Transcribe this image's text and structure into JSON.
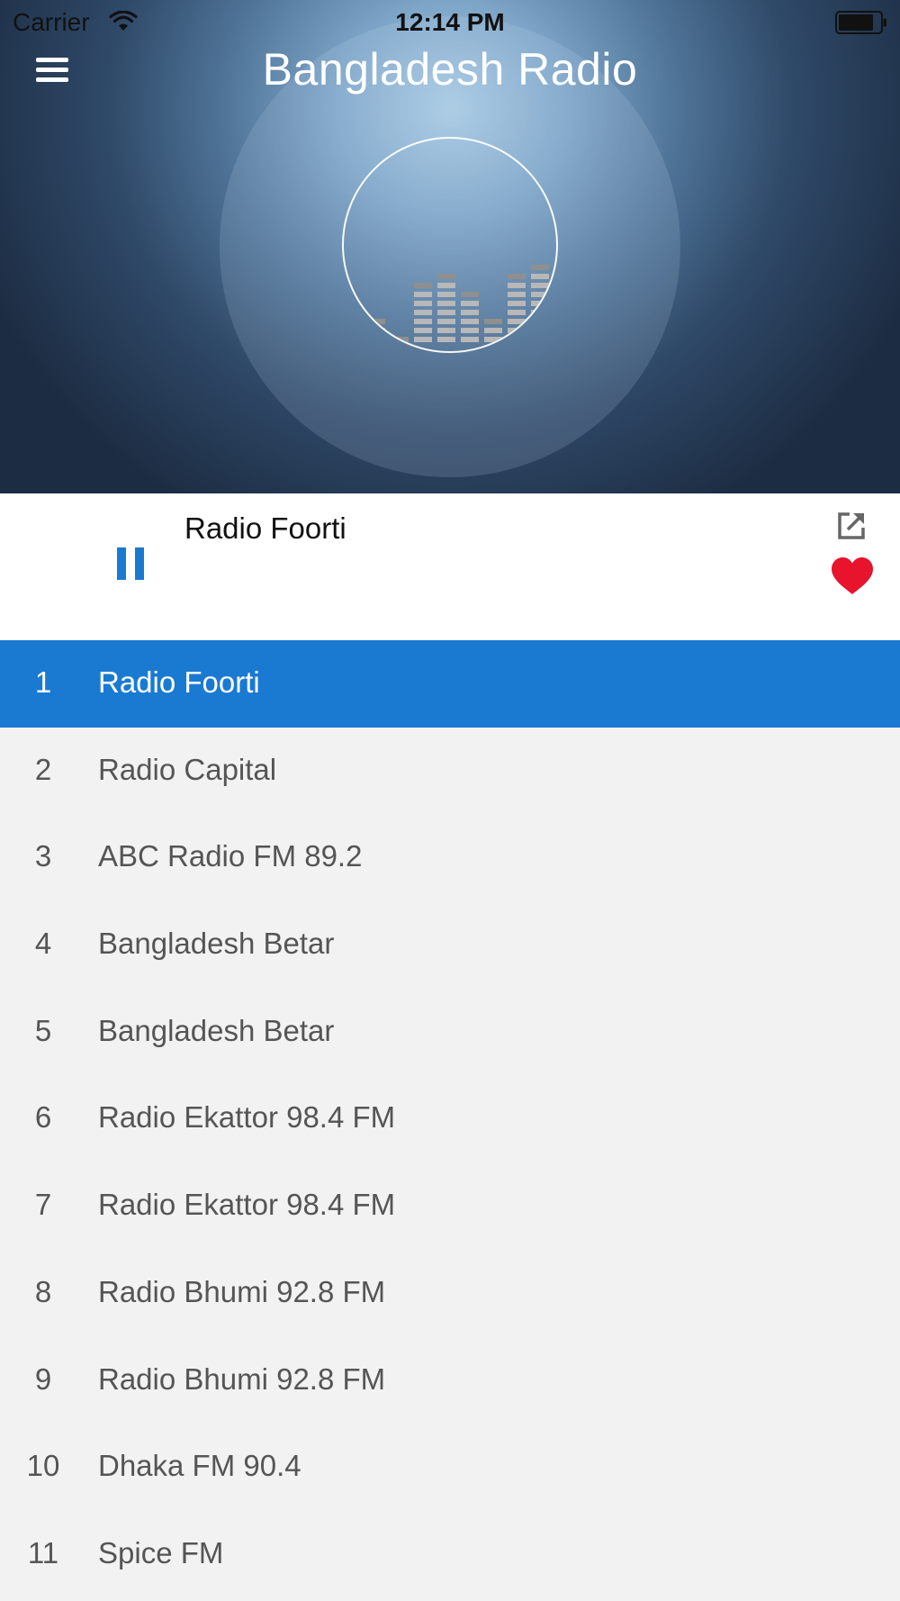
{
  "status_bar": {
    "carrier": "Carrier",
    "time": "12:14 PM"
  },
  "header": {
    "title": "Bangladesh Radio",
    "menu_icon": "hamburger-menu-icon"
  },
  "colors": {
    "accent": "#1a7ad2",
    "favorite": "#e8132d",
    "list_background": "#f2f2f2"
  },
  "now_playing": {
    "station": "Radio Foorti",
    "state": "playing",
    "control_icon": "pause-icon",
    "share_icon": "share-external-icon",
    "favorite_icon": "heart-icon",
    "favorited": true
  },
  "stations": [
    {
      "number": "1",
      "name": "Radio Foorti",
      "active": true
    },
    {
      "number": "2",
      "name": "Radio Capital",
      "active": false
    },
    {
      "number": "3",
      "name": "ABC Radio FM 89.2",
      "active": false
    },
    {
      "number": "4",
      "name": "Bangladesh Betar",
      "active": false
    },
    {
      "number": "5",
      "name": "Bangladesh Betar",
      "active": false
    },
    {
      "number": "6",
      "name": "Radio Ekattor 98.4 FM",
      "active": false
    },
    {
      "number": "7",
      "name": "Radio Ekattor 98.4 FM",
      "active": false
    },
    {
      "number": "8",
      "name": "Radio Bhumi 92.8 FM",
      "active": false
    },
    {
      "number": "9",
      "name": "Radio Bhumi 92.8 FM",
      "active": false
    },
    {
      "number": "10",
      "name": "Dhaka FM 90.4",
      "active": false
    },
    {
      "number": "11",
      "name": "Spice FM",
      "active": false
    }
  ]
}
